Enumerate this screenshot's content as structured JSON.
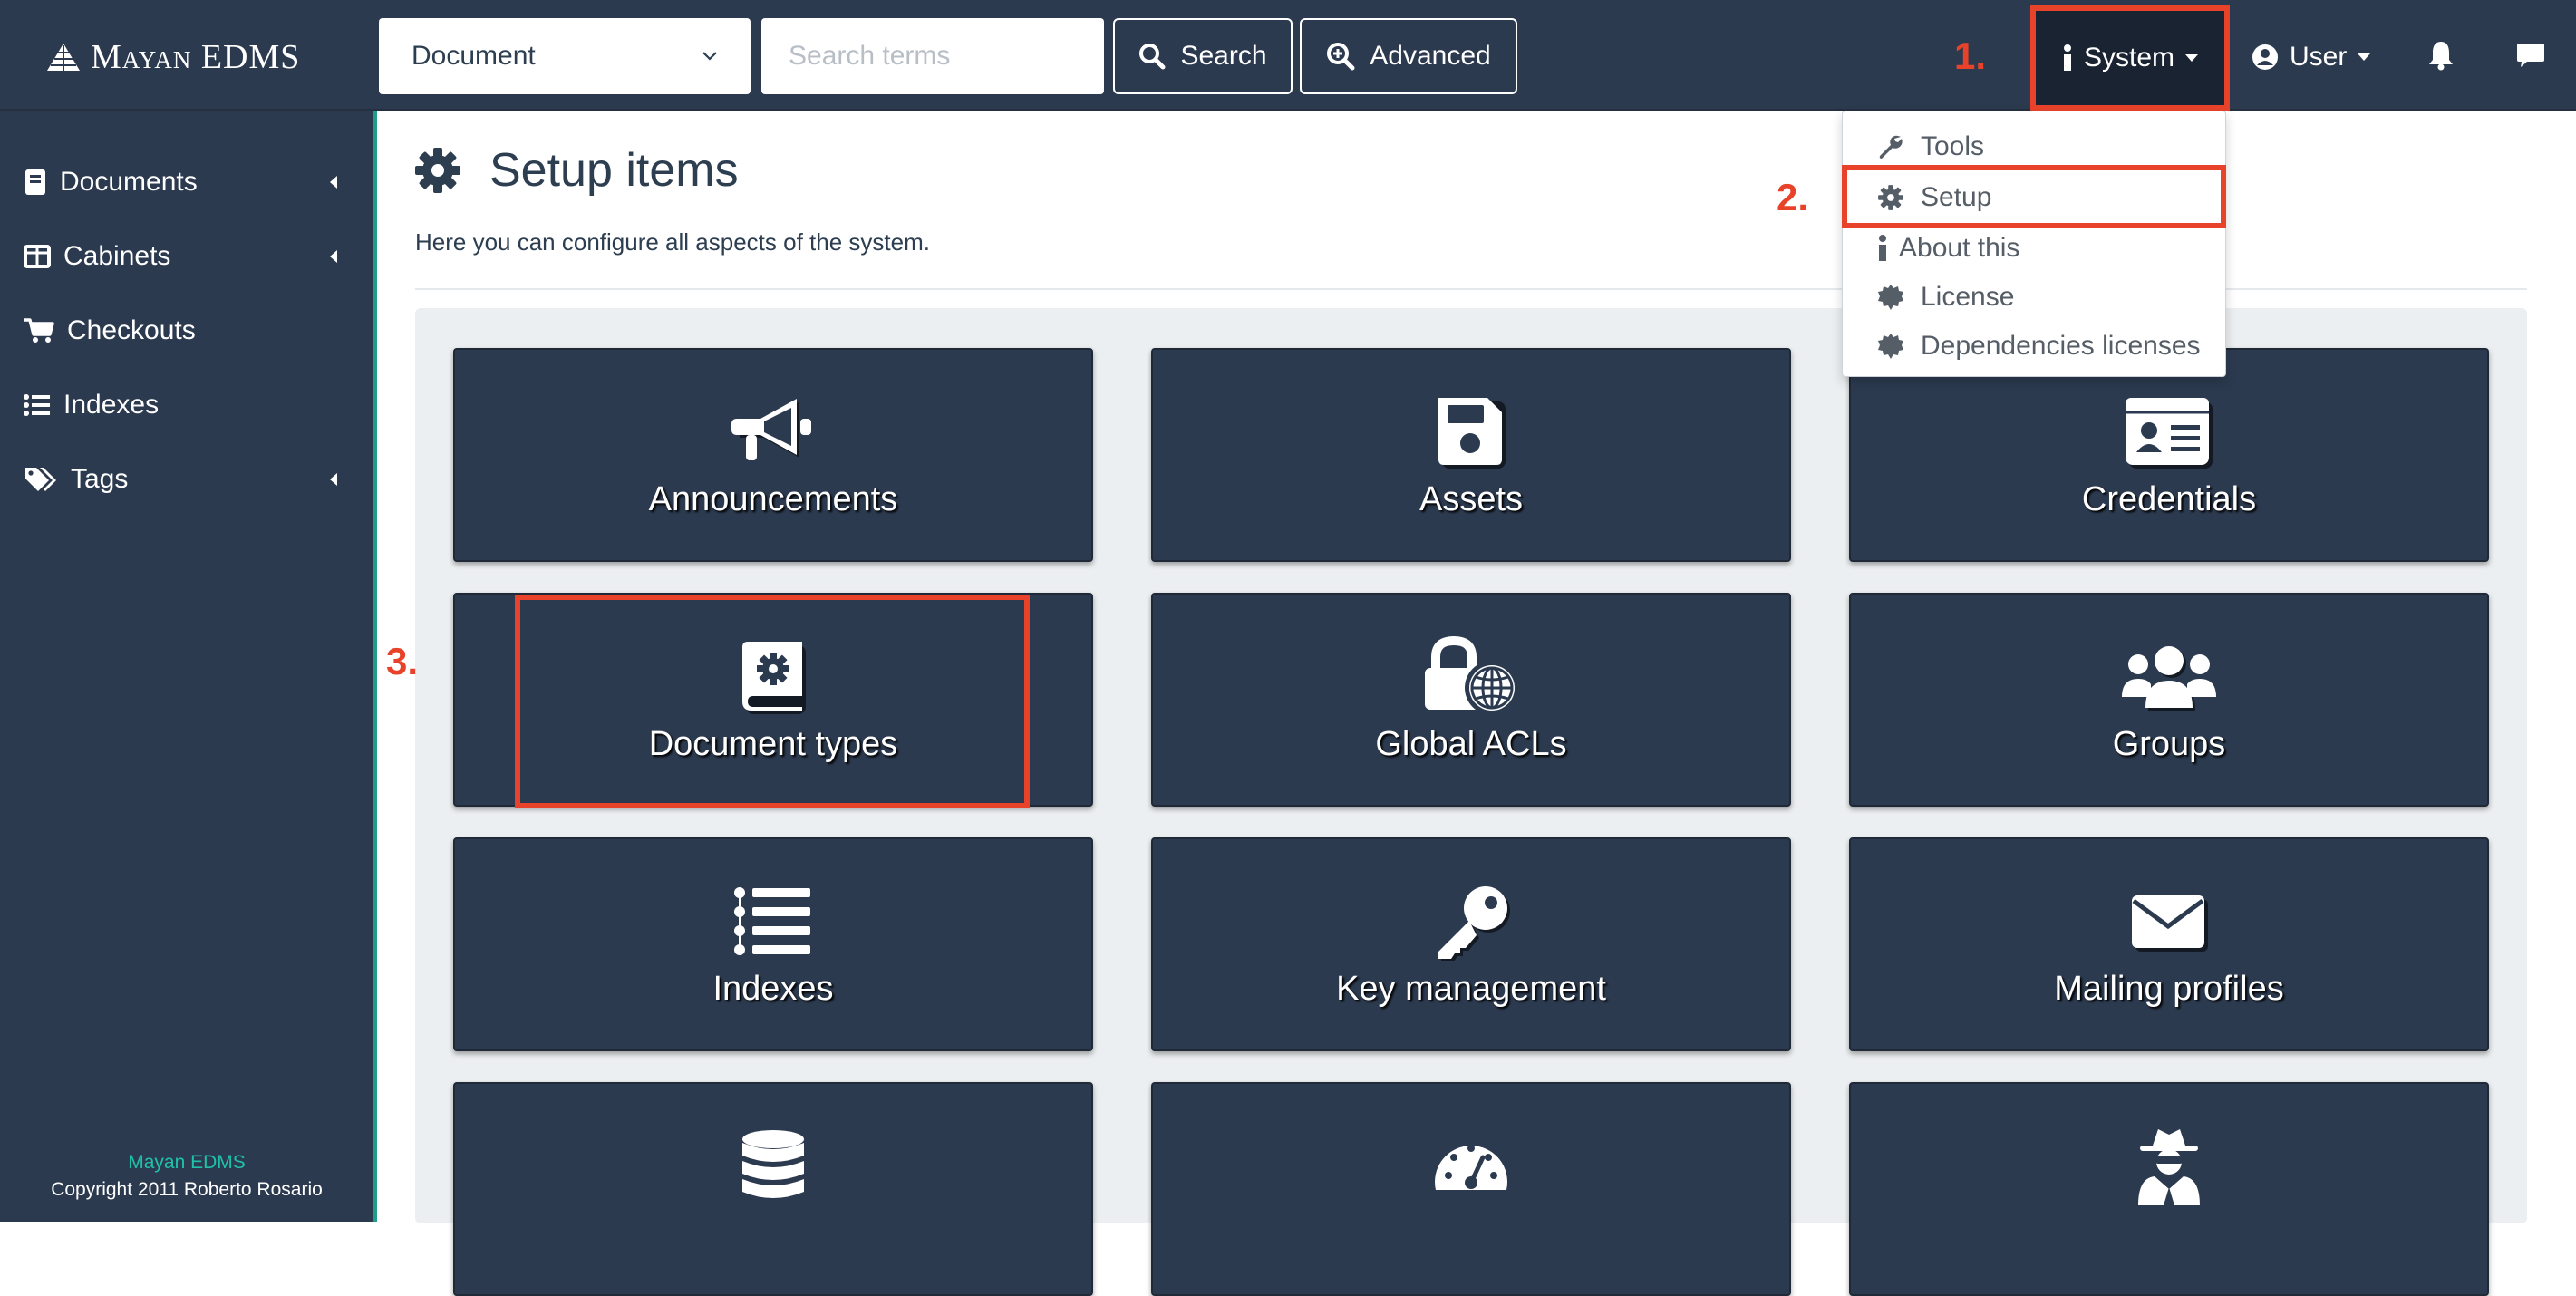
{
  "brand": {
    "first": "Mayan",
    "second": "EDMS"
  },
  "navbar": {
    "search_scope": "Document",
    "search_placeholder": "Search terms",
    "search_label": "Search",
    "advanced_label": "Advanced",
    "system_label": "System",
    "user_label": "User"
  },
  "annotations": {
    "step1": "1.",
    "step2": "2.",
    "step3": "3.",
    "highlight_color": "#e8432a"
  },
  "system_dropdown": {
    "items": [
      {
        "label": "Tools",
        "icon": "wrench-icon"
      },
      {
        "label": "Setup",
        "icon": "gear-icon"
      },
      {
        "label": "About this",
        "icon": "info-icon"
      },
      {
        "label": "License",
        "icon": "certificate-icon"
      },
      {
        "label": "Dependencies licenses",
        "icon": "certificate-icon"
      }
    ]
  },
  "sidebar": {
    "items": [
      {
        "label": "Documents",
        "icon": "book-icon",
        "expandable": true
      },
      {
        "label": "Cabinets",
        "icon": "columns-icon",
        "expandable": true
      },
      {
        "label": "Checkouts",
        "icon": "cart-icon",
        "expandable": false
      },
      {
        "label": "Indexes",
        "icon": "list-icon",
        "expandable": false
      },
      {
        "label": "Tags",
        "icon": "tags-icon",
        "expandable": true
      }
    ],
    "footer_app": "Mayan EDMS",
    "footer_copyright": "Copyright 2011 Roberto Rosario"
  },
  "main": {
    "title": "Setup items",
    "subtitle": "Here you can configure all aspects of the system.",
    "tiles": [
      {
        "label": "Announcements",
        "icon": "bullhorn-icon"
      },
      {
        "label": "Assets",
        "icon": "floppy-icon"
      },
      {
        "label": "Credentials",
        "icon": "id-card-icon"
      },
      {
        "label": "Document types",
        "icon": "book-gear-icon"
      },
      {
        "label": "Global ACLs",
        "icon": "lock-globe-icon"
      },
      {
        "label": "Groups",
        "icon": "users-icon"
      },
      {
        "label": "Indexes",
        "icon": "list-ol-icon"
      },
      {
        "label": "Key management",
        "icon": "key-icon"
      },
      {
        "label": "Mailing profiles",
        "icon": "envelope-icon"
      },
      {
        "label": "",
        "icon": "database-icon"
      },
      {
        "label": "",
        "icon": "tachometer-icon"
      },
      {
        "label": "",
        "icon": "user-secret-icon"
      }
    ]
  },
  "colors": {
    "navbar": "#2c3a4f",
    "accent": "#1e9c8d",
    "tile": "#2c3a4f",
    "panel": "#eceff1"
  }
}
